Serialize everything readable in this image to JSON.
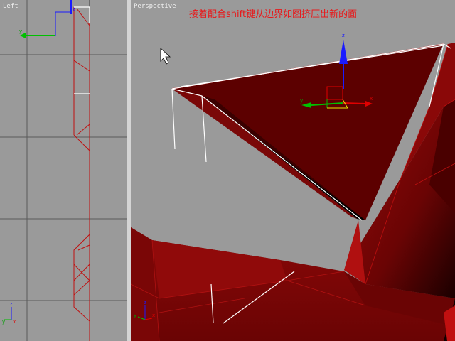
{
  "viewports": {
    "left": {
      "label": "Left"
    },
    "perspective": {
      "label": "Perspective"
    }
  },
  "caption": "接着配合shift键从边界如图挤压出新的面",
  "gizmo": {
    "x": "x",
    "y": "y",
    "z": "z"
  },
  "colors": {
    "viewport_bg": "#9a9a9a",
    "grid": "#5a5a5a",
    "mesh_red": "#8a0808",
    "mesh_dark": "#3a0000",
    "wire_red": "#c01010",
    "selection_white": "#ffffff",
    "caption_red": "#e8181a"
  }
}
